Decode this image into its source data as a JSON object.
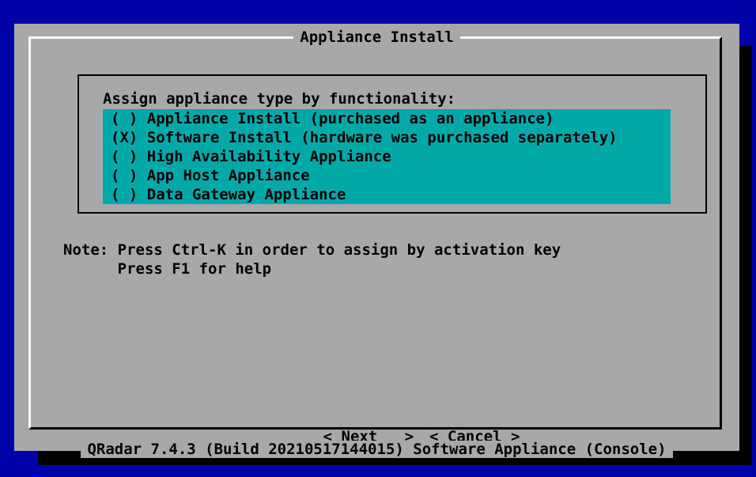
{
  "dialog": {
    "title": "Appliance Install",
    "group_title": "Assign appliance type by functionality:",
    "options": [
      {
        "marker": "( )",
        "label": "Appliance Install (purchased as an appliance)"
      },
      {
        "marker": "(X)",
        "label": "Software Install (hardware was purchased separately)"
      },
      {
        "marker": "( )",
        "label": "High Availability Appliance"
      },
      {
        "marker": "( )",
        "label": "App Host Appliance"
      },
      {
        "marker": "( )",
        "label": "Data Gateway Appliance"
      }
    ],
    "note_line1": "Note: Press Ctrl-K in order to assign by activation key",
    "note_line2": "      Press F1 for help",
    "next_button": "< Next   >",
    "cancel_button": "< Cancel >",
    "footer": "QRadar 7.4.3 (Build 20210517144015) Software Appliance (Console)"
  },
  "colors": {
    "background": "#0000a8",
    "dialog": "#a8a8a8",
    "selection": "#00a8a8",
    "shadow": "#000000"
  }
}
